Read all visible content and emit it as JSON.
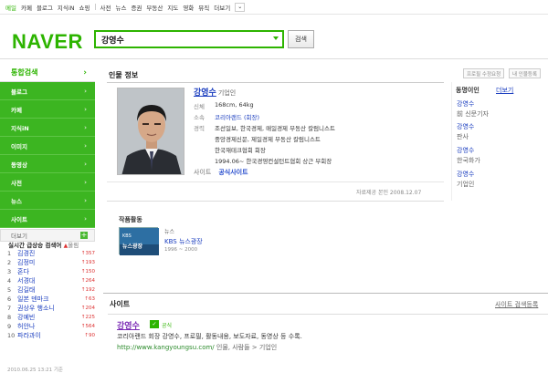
{
  "topnav": {
    "items": [
      "메일",
      "카페",
      "블로그",
      "지식iN",
      "쇼핑",
      "사전",
      "뉴스",
      "증권",
      "부동산",
      "지도",
      "영화",
      "뮤직"
    ],
    "more": "더보기"
  },
  "header": {
    "logo": "NAVER",
    "query": "강영수",
    "search_button": "검색"
  },
  "sidebar": {
    "head": "통합검색",
    "items": [
      "블로그",
      "카페",
      "지식iN",
      "이미지",
      "동영상",
      "사전",
      "뉴스",
      "사이트"
    ],
    "more": "더보기"
  },
  "realtime": {
    "title": "실시간 급상승 검색어",
    "direction": "올림",
    "list": [
      {
        "rank": "1",
        "word": "김경진",
        "delta": "357"
      },
      {
        "rank": "2",
        "word": "김정미",
        "delta": "193"
      },
      {
        "rank": "3",
        "word": "혼다",
        "delta": "150"
      },
      {
        "rank": "4",
        "word": "서경대",
        "delta": "264"
      },
      {
        "rank": "5",
        "word": "김길태",
        "delta": "192"
      },
      {
        "rank": "6",
        "word": "일본 덴마크",
        "delta": "63"
      },
      {
        "rank": "7",
        "word": "권상우 행소니",
        "delta": "204"
      },
      {
        "rank": "8",
        "word": "강예빈",
        "delta": "225"
      },
      {
        "rank": "9",
        "word": "허안나",
        "delta": "564"
      },
      {
        "rank": "10",
        "word": "파라과이",
        "delta": "90"
      }
    ],
    "time": "2010.06.25 13:21 기준"
  },
  "person": {
    "section_title": "인물 정보",
    "btn_edit": "프로필 수정요청",
    "btn_register": "내 인물등록",
    "name": "강영수",
    "occupation": "기업인",
    "rows": [
      {
        "label": "신체",
        "value": "168cm, 64kg"
      },
      {
        "label": "소속",
        "value": "코리아랜드 (회장)"
      },
      {
        "label": "경력",
        "value": "조선일보, 한국경제, 매일경제 부동산 칼럼니스트"
      },
      {
        "label": "",
        "value": "중앙경제신문, 제일경제 부동산 칼럼니스트"
      },
      {
        "label": "",
        "value": "한국재테크협회 회장"
      },
      {
        "label": "",
        "value": "1994.06~ 한국경영컨설턴트협회 상근 부회장"
      }
    ],
    "site_label": "사이트",
    "site_link": "공식사이트",
    "source": "자료제공  본인 2008.12.07"
  },
  "works": {
    "title": "작품활동",
    "category": "뉴스",
    "name": "KBS 뉴스광장",
    "years": "1996 ~ 2000",
    "thumb_text": "뉴스광장"
  },
  "same_name": {
    "title": "동명이인",
    "more": "더보기",
    "items": [
      {
        "name": "강영수",
        "occupation": "前 신문기자"
      },
      {
        "name": "강영수",
        "occupation": "판사"
      },
      {
        "name": "강영수",
        "occupation": "한국화가"
      },
      {
        "name": "강영수",
        "occupation": "기업인"
      }
    ]
  },
  "site": {
    "title": "사이트",
    "more_link": "사이트 검색등록",
    "name": "강영수",
    "badge": "공식",
    "description": "코리아랜드 회장 강영수, 프로필, 활동내용, 보도자료, 동영상 등 수록.",
    "url": "http://www.kangyoungsu.com/",
    "path": "인물, 사람들 > 기업인"
  },
  "colors": {
    "brand": "#2db400",
    "link": "#1a3dbf"
  }
}
